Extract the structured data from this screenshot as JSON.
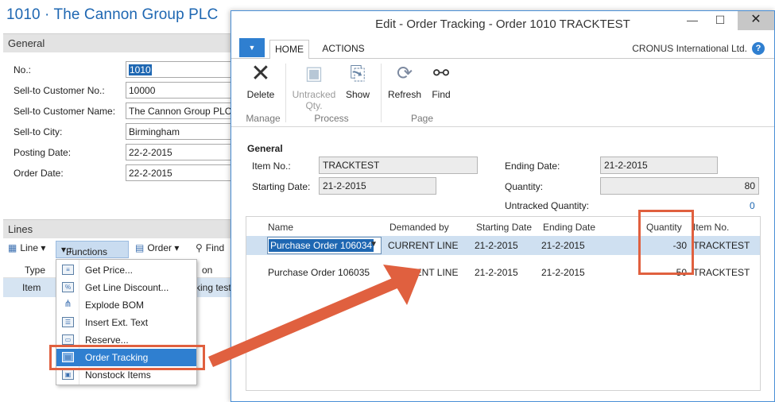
{
  "background": {
    "title": "1010 · The Cannon Group PLC",
    "general": {
      "header": "General",
      "fields": [
        {
          "label": "No.:",
          "value": "1010"
        },
        {
          "label": "Sell-to Customer No.:",
          "value": "10000"
        },
        {
          "label": "Sell-to Customer Name:",
          "value": "The Cannon Group PLC"
        },
        {
          "label": "Sell-to City:",
          "value": "Birmingham"
        },
        {
          "label": "Posting Date:",
          "value": "22-2-2015"
        },
        {
          "label": "Order Date:",
          "value": "22-2-2015"
        }
      ]
    },
    "lines": {
      "header": "Lines",
      "toolbar": {
        "line": "Line",
        "functions": "Functions",
        "order": "Order",
        "find": "Find"
      },
      "column_type": "Type",
      "column_desc_fragment": "on",
      "row_type": "Item",
      "row_desc_fragment": "king test"
    },
    "functions_menu": [
      {
        "label": "Get Price...",
        "icon": "get-price-icon"
      },
      {
        "label": "Get Line Discount...",
        "icon": "discount-icon"
      },
      {
        "label": "Explode BOM",
        "icon": "bom-icon"
      },
      {
        "label": "Insert Ext. Text",
        "icon": "ext-text-icon"
      },
      {
        "label": "Reserve...",
        "icon": "reserve-icon"
      },
      {
        "label": "Order Tracking",
        "icon": "order-tracking-icon",
        "selected": true
      },
      {
        "label": "Nonstock Items",
        "icon": "nonstock-icon"
      }
    ]
  },
  "dialog": {
    "title": "Edit - Order Tracking - Order 1010 TRACKTEST",
    "tabs": {
      "home": "HOME",
      "actions": "ACTIONS"
    },
    "company": "CRONUS International Ltd.",
    "help": "?",
    "ribbon": {
      "delete": "Delete",
      "untracked_line1": "Untracked",
      "untracked_line2": "Qty.",
      "show": "Show",
      "refresh": "Refresh",
      "find": "Find",
      "group_manage": "Manage",
      "group_process": "Process",
      "group_page": "Page"
    },
    "general": {
      "header": "General",
      "item_no_label": "Item No.:",
      "item_no_value": "TRACKTEST",
      "starting_date_label": "Starting Date:",
      "starting_date_value": "21-2-2015",
      "ending_date_label": "Ending Date:",
      "ending_date_value": "21-2-2015",
      "quantity_label": "Quantity:",
      "quantity_value": "80",
      "untracked_label": "Untracked Quantity:",
      "untracked_value": "0"
    },
    "grid": {
      "columns": {
        "name": "Name",
        "demanded_by": "Demanded by",
        "starting_date": "Starting Date",
        "ending_date": "Ending Date",
        "quantity": "Quantity",
        "item_no": "Item No."
      },
      "rows": [
        {
          "name": "Purchase Order 106034",
          "demanded_by": "CURRENT LINE",
          "starting_date": "21-2-2015",
          "ending_date": "21-2-2015",
          "quantity": "-30",
          "item_no": "TRACKTEST"
        },
        {
          "name": "Purchase Order 106035",
          "demanded_by": "CURRENT LINE",
          "starting_date": "21-2-2015",
          "ending_date": "21-2-2015",
          "quantity": "-50",
          "item_no": "TRACKTEST"
        }
      ]
    }
  },
  "colors": {
    "accent": "#2f7fd0",
    "title_blue": "#1e67b2",
    "highlight": "#e0603f",
    "selected_row": "#cfe0f1"
  }
}
